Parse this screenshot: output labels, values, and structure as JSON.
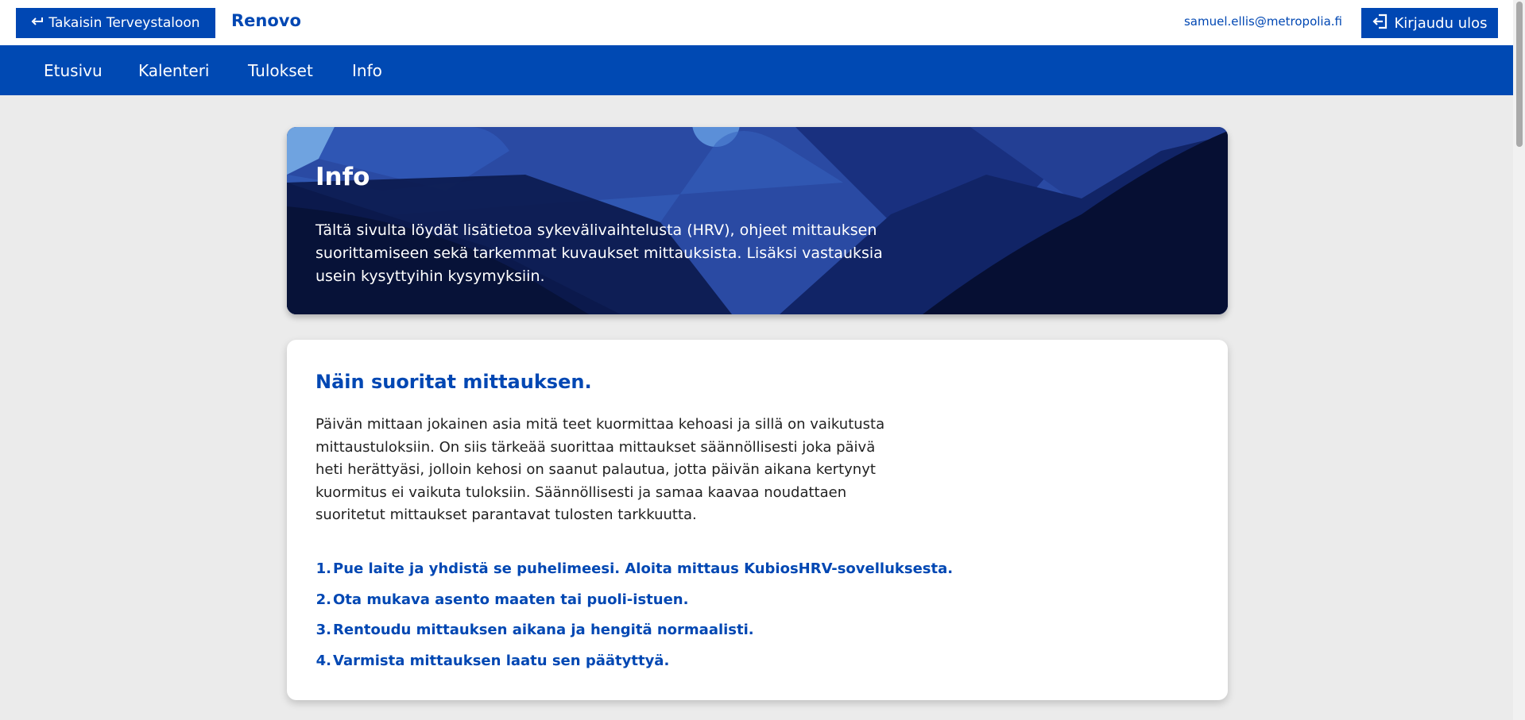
{
  "topbar": {
    "back_label": "Takaisin Terveystaloon",
    "brand": "Renovo",
    "user_email": "samuel.ellis@metropolia.fi",
    "logout_label": "Kirjaudu ulos"
  },
  "nav": {
    "items": [
      {
        "label": "Etusivu"
      },
      {
        "label": "Kalenteri"
      },
      {
        "label": "Tulokset"
      },
      {
        "label": "Info"
      }
    ]
  },
  "hero": {
    "title": "Info",
    "text": "Tältä sivulta löydät lisätietoa sykevälivaihtelusta (HRV), ohjeet mittauksen suorittamiseen sekä tarkemmat kuvaukset mittauksista. Lisäksi vastauksia usein kysyttyihin kysymyksiin."
  },
  "card": {
    "title": "Näin suoritat mittauksen.",
    "text": "Päivän mittaan jokainen asia mitä teet kuormittaa kehoasi ja sillä on vaikutusta mittaustuloksiin. On siis tärkeää suorittaa mittaukset säännöllisesti joka päivä heti herättyäsi, jolloin kehosi on saanut palautua, jotta päivän aikana kertynyt kuormitus ei vaikuta tuloksiin. Säännöllisesti ja samaa kaavaa noudattaen suoritetut mittaukset parantavat tulosten tarkkuutta.",
    "steps": [
      {
        "num": "1.",
        "text": "Pue laite ja yhdistä se puhelimeesi. Aloita mittaus KubiosHRV-sovelluksesta."
      },
      {
        "num": "2.",
        "text": "Ota mukava asento maaten tai puoli-istuen."
      },
      {
        "num": "3.",
        "text": "Rentoudu mittauksen aikana ja hengitä normaalisti."
      },
      {
        "num": "4.",
        "text": "Varmista mittauksen laatu sen päätyttyä."
      }
    ]
  },
  "colors": {
    "brand_blue": "#0047b3",
    "nav_blue": "#0049b3",
    "page_bg": "#ebebeb"
  },
  "icons": {
    "back": "return-arrow-icon",
    "logout": "logout-icon"
  }
}
